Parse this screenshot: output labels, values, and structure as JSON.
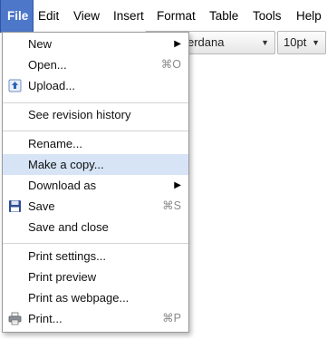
{
  "menubar": {
    "items": [
      {
        "label": "File"
      },
      {
        "label": "Edit"
      },
      {
        "label": "View"
      },
      {
        "label": "Insert"
      },
      {
        "label": "Format"
      },
      {
        "label": "Table"
      },
      {
        "label": "Tools"
      },
      {
        "label": "Help"
      }
    ]
  },
  "toolbar": {
    "font_name": "erdana",
    "font_size": "10pt"
  },
  "file_menu": {
    "new": {
      "label": "New"
    },
    "open": {
      "label": "Open...",
      "shortcut": "⌘O"
    },
    "upload": {
      "label": "Upload...",
      "icon": "upload-icon"
    },
    "revision_history": {
      "label": "See revision history"
    },
    "rename": {
      "label": "Rename..."
    },
    "make_copy": {
      "label": "Make a copy...",
      "highlighted": true
    },
    "download_as": {
      "label": "Download as"
    },
    "save": {
      "label": "Save",
      "shortcut": "⌘S",
      "icon": "floppy-disk-icon"
    },
    "save_close": {
      "label": "Save and close"
    },
    "print_settings": {
      "label": "Print settings..."
    },
    "print_preview": {
      "label": "Print preview"
    },
    "print_webpage": {
      "label": "Print as webpage..."
    },
    "print": {
      "label": "Print...",
      "shortcut": "⌘P",
      "icon": "printer-icon"
    }
  },
  "colors": {
    "active_menu": "#4d77c8",
    "highlight": "#d6e4f5",
    "shortcut_text": "#8a8a8a"
  }
}
